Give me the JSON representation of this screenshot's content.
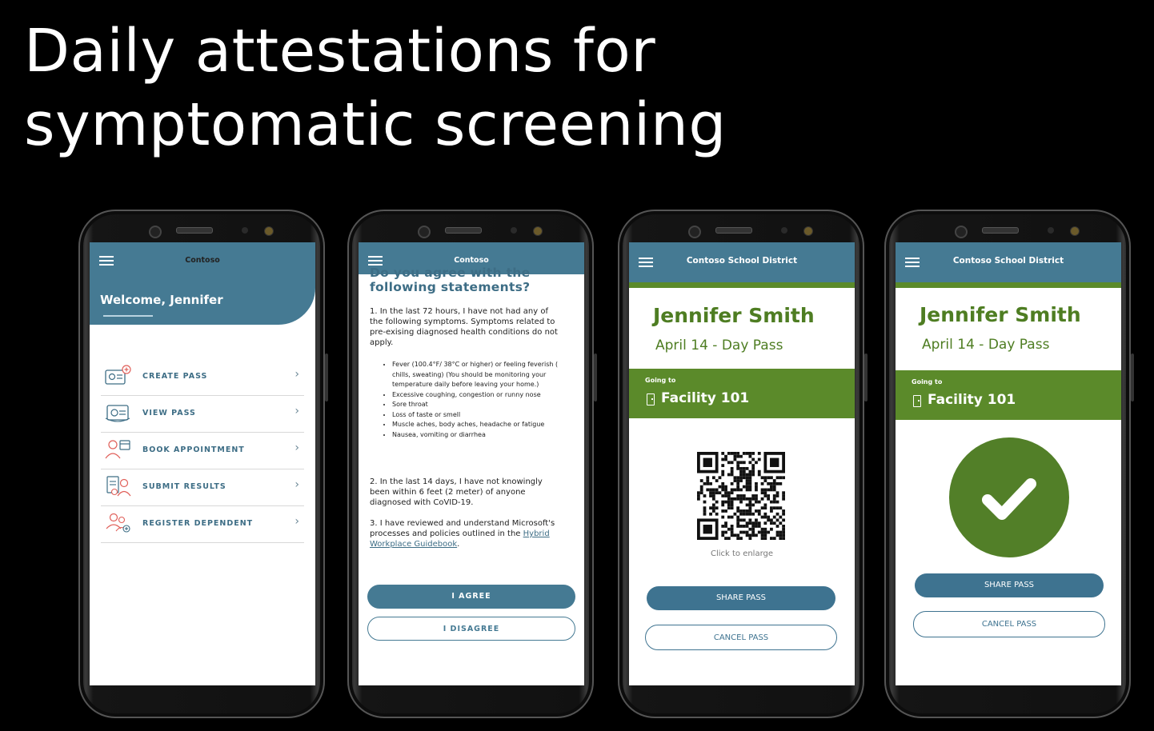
{
  "slide": {
    "title": "Daily attestations for symptomatic screening"
  },
  "phone1": {
    "app_title": "Contoso",
    "welcome": "Welcome, Jennifer",
    "menu": [
      {
        "label": "CREATE PASS",
        "icon": "create-pass-icon"
      },
      {
        "label": "VIEW PASS",
        "icon": "view-pass-icon"
      },
      {
        "label": "BOOK APPOINTMENT",
        "icon": "book-appointment-icon"
      },
      {
        "label": "SUBMIT RESULTS",
        "icon": "submit-results-icon"
      },
      {
        "label": "REGISTER DEPENDENT",
        "icon": "register-dependent-icon"
      }
    ]
  },
  "phone2": {
    "app_title": "Contoso",
    "question": "Do you agree with the following statements?",
    "statement1": "1.  In the last 72 hours, I have not had any of the following symptoms. Symptoms related to pre-exising diagnosed health conditions do not apply.",
    "symptoms": [
      "Fever (100.4°F/ 38°C or higher) or feeling feverish ( chills, sweating) (You should be monitoring your temperature daily before leaving your home.)",
      "Excessive coughing, congestion or runny nose",
      "Sore throat",
      "Loss of taste or smell",
      "Muscle aches, body aches, headache or fatigue",
      "Nausea, vomiting or diarrhea"
    ],
    "statement2": "2.   In the last 14 days, I have not knowingly been within 6 feet (2 meter) of anyone diagnosed with CoVID-19.",
    "statement3_prefix": "3.   I have reviewed and understand Microsoft's processes and policies outlined in the ",
    "statement3_link": "Hybrid Workplace Guidebook",
    "statement3_suffix": ".",
    "agree_label": "I AGREE",
    "disagree_label": "I DISAGREE"
  },
  "phone3": {
    "app_title": "Contoso School District",
    "name": "Jennifer Smith",
    "pass_date": "April 14 - Day Pass",
    "going_to_label": "Going to",
    "facility": "Facility 101",
    "enlarge_hint": "Click to enlarge",
    "share_label": "SHARE PASS",
    "cancel_label": "CANCEL PASS"
  },
  "phone4": {
    "app_title": "Contoso School District",
    "name": "Jennifer Smith",
    "pass_date": "April 14 - Day Pass",
    "going_to_label": "Going to",
    "facility": "Facility 101",
    "share_label": "SHARE PASS",
    "cancel_label": "CANCEL PASS"
  },
  "colors": {
    "teal": "#457a93",
    "green": "#5b8a2a",
    "dark_green": "#4e7d22"
  }
}
